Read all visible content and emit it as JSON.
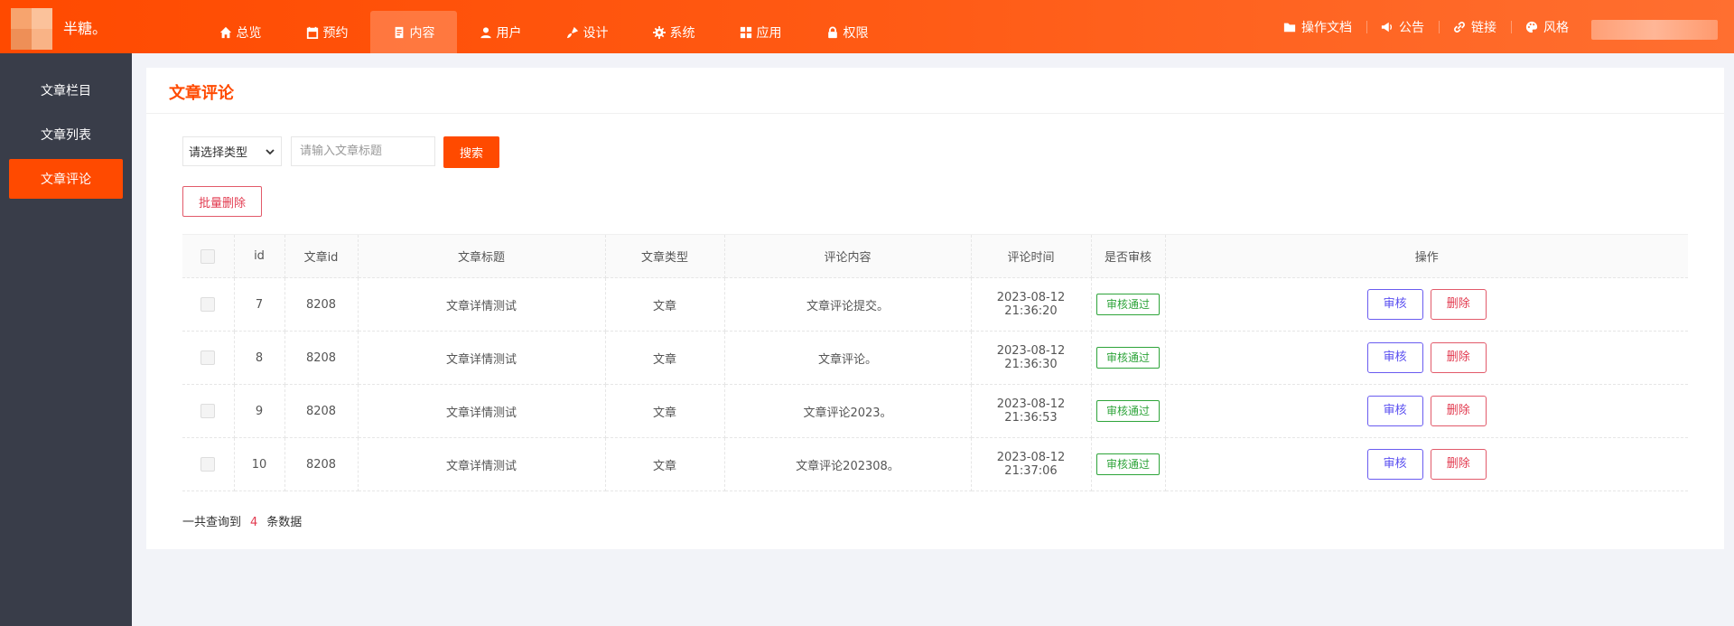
{
  "brand": {
    "name": "半糖。"
  },
  "nav": [
    {
      "label": "总览",
      "icon": "home-icon"
    },
    {
      "label": "预约",
      "icon": "calendar-icon"
    },
    {
      "label": "内容",
      "icon": "document-icon",
      "active": true
    },
    {
      "label": "用户",
      "icon": "user-icon"
    },
    {
      "label": "设计",
      "icon": "paint-icon"
    },
    {
      "label": "系统",
      "icon": "gear-icon"
    },
    {
      "label": "应用",
      "icon": "grid-icon"
    },
    {
      "label": "权限",
      "icon": "lock-icon"
    }
  ],
  "right_menu": [
    {
      "label": "操作文档",
      "icon": "folder-icon"
    },
    {
      "label": "公告",
      "icon": "megaphone-icon"
    },
    {
      "label": "链接",
      "icon": "link-icon"
    },
    {
      "label": "风格",
      "icon": "palette-icon"
    }
  ],
  "sidebar": {
    "items": [
      {
        "label": "文章栏目"
      },
      {
        "label": "文章列表"
      },
      {
        "label": "文章评论",
        "active": true
      }
    ]
  },
  "page": {
    "title": "文章评论",
    "select_placeholder": "请选择类型",
    "search_placeholder": "请输入文章标题",
    "search_label": "搜索",
    "batch_delete_label": "批量删除"
  },
  "table": {
    "headers": [
      "id",
      "文章id",
      "文章标题",
      "文章类型",
      "评论内容",
      "评论时间",
      "是否审核",
      "操作"
    ],
    "rows": [
      {
        "id": "7",
        "article_id": "8208",
        "title": "文章详情测试",
        "type": "文章",
        "content": "文章评论提交。",
        "time": "2023-08-12 21:36:20",
        "status": "审核通过"
      },
      {
        "id": "8",
        "article_id": "8208",
        "title": "文章详情测试",
        "type": "文章",
        "content": "文章评论。",
        "time": "2023-08-12 21:36:30",
        "status": "审核通过"
      },
      {
        "id": "9",
        "article_id": "8208",
        "title": "文章详情测试",
        "type": "文章",
        "content": "文章评论2023。",
        "time": "2023-08-12 21:36:53",
        "status": "审核通过"
      },
      {
        "id": "10",
        "article_id": "8208",
        "title": "文章详情测试",
        "type": "文章",
        "content": "文章评论202308。",
        "time": "2023-08-12 21:37:06",
        "status": "审核通过"
      }
    ],
    "review_label": "审核",
    "delete_label": "删除"
  },
  "footer": {
    "prefix": "一共查询到",
    "count": "4",
    "suffix": "条数据"
  },
  "colors": {
    "accent": "#ff4a00",
    "sidebar": "#393d49",
    "success": "#2ea43a",
    "danger": "#e23a4f",
    "review": "#5a4ff0"
  }
}
